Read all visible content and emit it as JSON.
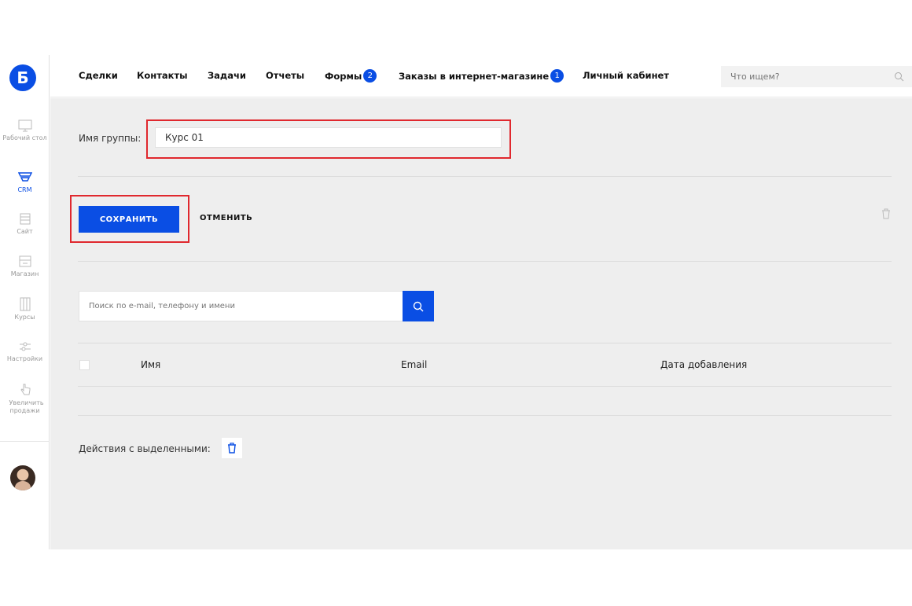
{
  "logo": {
    "letter": "Б"
  },
  "sidebar": {
    "items": [
      {
        "label": "Рабочий стол",
        "icon": "monitor-icon"
      },
      {
        "label": "CRM",
        "icon": "funnel-icon",
        "active": true
      },
      {
        "label": "Сайт",
        "icon": "site-icon"
      },
      {
        "label": "Магазин",
        "icon": "shop-icon"
      },
      {
        "label": "Курсы",
        "icon": "courses-icon"
      },
      {
        "label": "Настройки",
        "icon": "settings-sliders-icon"
      },
      {
        "label": "Увеличить продажи",
        "icon": "hand-pointer-icon"
      }
    ]
  },
  "topnav": {
    "items": [
      {
        "label": "Сделки"
      },
      {
        "label": "Контакты"
      },
      {
        "label": "Задачи"
      },
      {
        "label": "Отчеты"
      },
      {
        "label": "Формы",
        "badge": "2"
      },
      {
        "label": "Заказы в интернет-магазине",
        "badge": "1"
      },
      {
        "label": "Личный кабинет"
      }
    ],
    "search_placeholder": "Что ищем?"
  },
  "form": {
    "group_label": "Имя группы:",
    "group_value": "Курс 01",
    "save_label": "СОХРАНИТЬ",
    "cancel_label": "ОТМЕНИТЬ"
  },
  "members": {
    "search_placeholder": "Поиск по e-mail, телефону и имени",
    "columns": [
      "Имя",
      "Email",
      "Дата добавления"
    ],
    "actions_label": "Действия с выделенными:"
  },
  "colors": {
    "accent": "#0a4ee4",
    "highlight": "#e0282e",
    "content_bg": "#eeeeee"
  }
}
